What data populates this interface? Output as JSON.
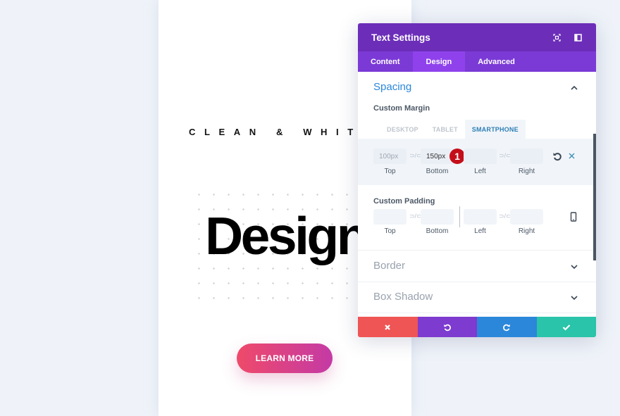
{
  "page": {
    "tagline": "CLEAN & WHITE",
    "headline": "Design",
    "cta_label": "LEARN MORE"
  },
  "panel": {
    "title": "Text Settings",
    "header_icons": [
      "fullscreen-icon",
      "sidebar-toggle-icon"
    ],
    "tabs": [
      {
        "label": "Content",
        "active": false
      },
      {
        "label": "Design",
        "active": true
      },
      {
        "label": "Advanced",
        "active": false
      }
    ],
    "spacing": {
      "title": "Spacing",
      "expanded": true,
      "custom_margin": {
        "label": "Custom Margin",
        "device_tabs": [
          {
            "label": "DESKTOP",
            "active": false
          },
          {
            "label": "TABLET",
            "active": false
          },
          {
            "label": "SMARTPHONE",
            "active": true
          }
        ],
        "fields": [
          {
            "side": "Top",
            "value": "100px"
          },
          {
            "side": "Bottom",
            "value": "150px"
          },
          {
            "side": "Left",
            "value": ""
          },
          {
            "side": "Right",
            "value": ""
          }
        ],
        "annotation_badge": "1"
      },
      "custom_padding": {
        "label": "Custom Padding",
        "fields": [
          {
            "side": "Top",
            "value": ""
          },
          {
            "side": "Bottom",
            "value": ""
          },
          {
            "side": "Left",
            "value": ""
          },
          {
            "side": "Right",
            "value": ""
          }
        ]
      }
    },
    "sections": [
      {
        "title": "Border",
        "expanded": false
      },
      {
        "title": "Box Shadow",
        "expanded": false
      }
    ],
    "colors": {
      "header": "#6c2eb9",
      "tabs": "#7b3ad6",
      "cancel": "#ef5555",
      "undo": "#7d3bcf",
      "redo": "#2b87da",
      "save": "#29c4a9"
    }
  }
}
